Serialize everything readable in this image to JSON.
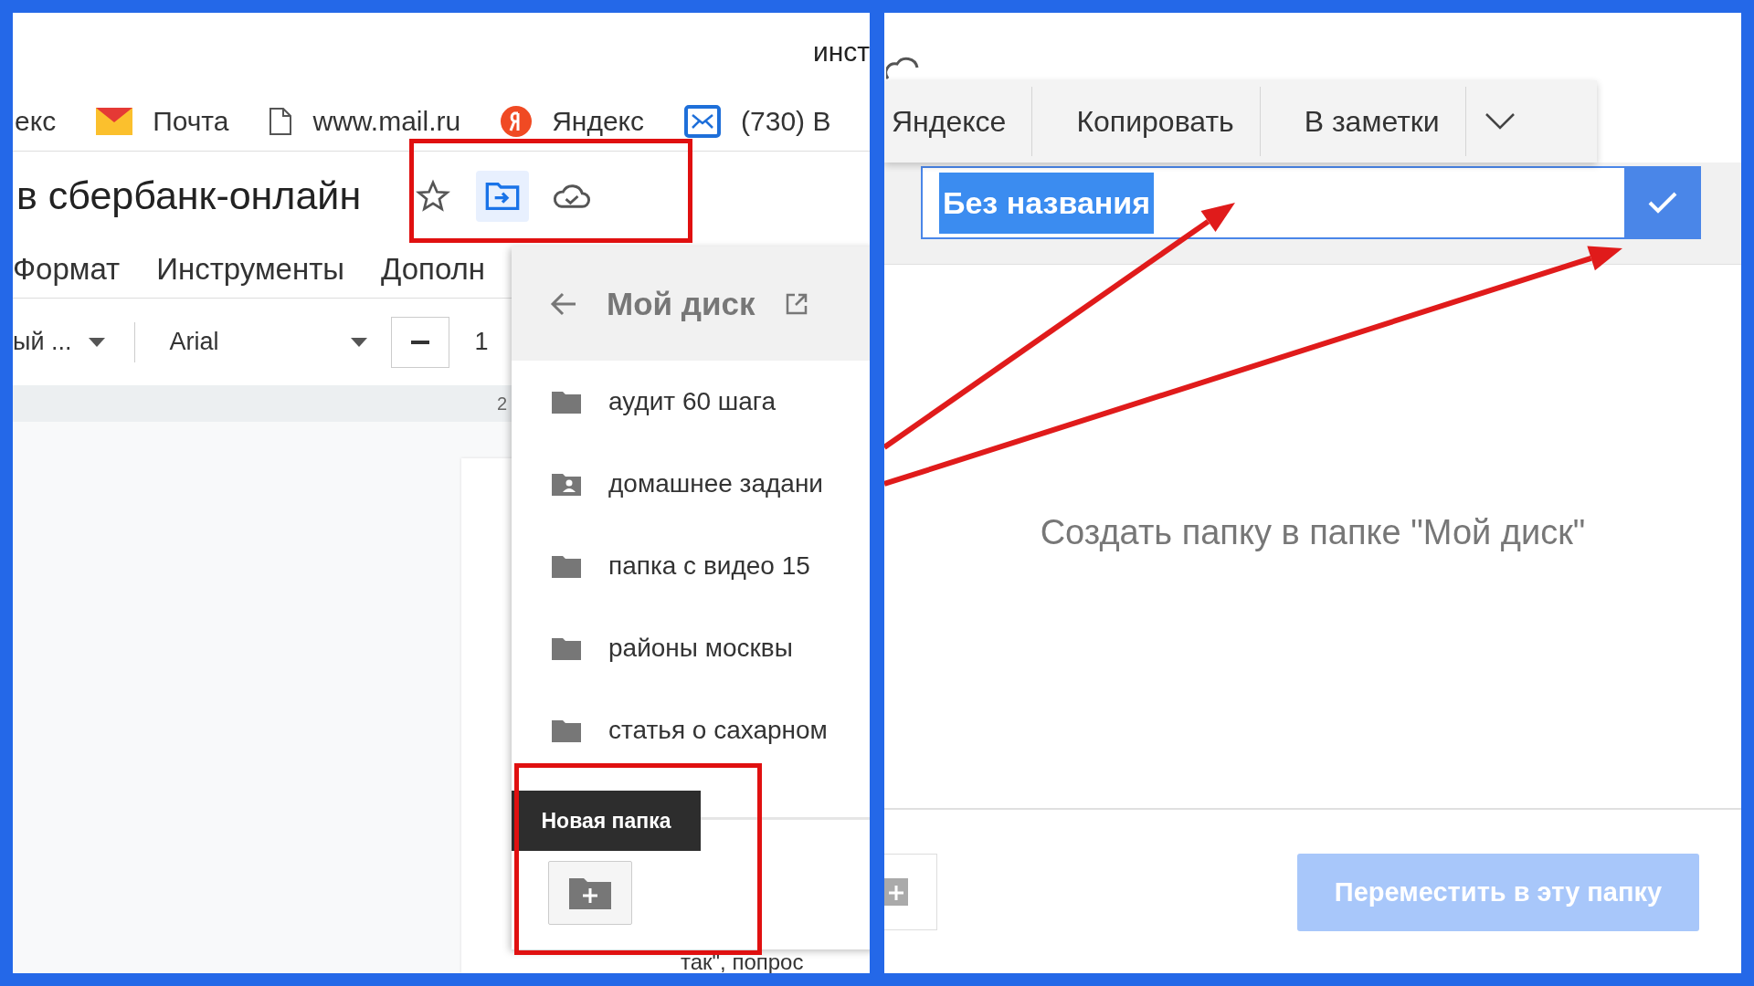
{
  "left_screen": {
    "tab_title_fragment": "инст",
    "bookmarks": [
      {
        "kind": "text",
        "label": "екс"
      },
      {
        "kind": "mail",
        "label": "Почта"
      },
      {
        "kind": "page",
        "label": "www.mail.ru"
      },
      {
        "kind": "yandex",
        "label": "Яндекс"
      },
      {
        "kind": "inbox",
        "label": "(730) В"
      }
    ],
    "document_title": "в сбербанк-онлайн",
    "title_actions": [
      {
        "kind": "star",
        "selected": false
      },
      {
        "kind": "move",
        "selected": true
      },
      {
        "kind": "cloud",
        "selected": false
      }
    ],
    "menu": [
      "Формат",
      "Инструменты",
      "Дополн"
    ],
    "toolbar": {
      "style_select": "ый ...",
      "font_select": "Arial",
      "font_size": "1"
    },
    "ruler_mark": "2",
    "document_text": "так\", попрос",
    "move_dialog": {
      "title": "Мой диск",
      "folders": [
        {
          "name": "аудит 60 шага",
          "shared": false
        },
        {
          "name": "домашнее задани",
          "shared": true
        },
        {
          "name": "папка с видео 15",
          "shared": false
        },
        {
          "name": "районы москвы",
          "shared": false
        },
        {
          "name": "статья о сахарном",
          "shared": false
        }
      ],
      "tooltip": "Новая папка"
    }
  },
  "right_screen": {
    "context_menu": [
      "Яндексе",
      "Копировать",
      "В заметки"
    ],
    "new_folder_name": "Без названия",
    "name_selected": true,
    "message": "Создать папку в папке \"Мой диск\"",
    "move_button": {
      "label": "Переместить в эту папку",
      "disabled": true
    }
  }
}
